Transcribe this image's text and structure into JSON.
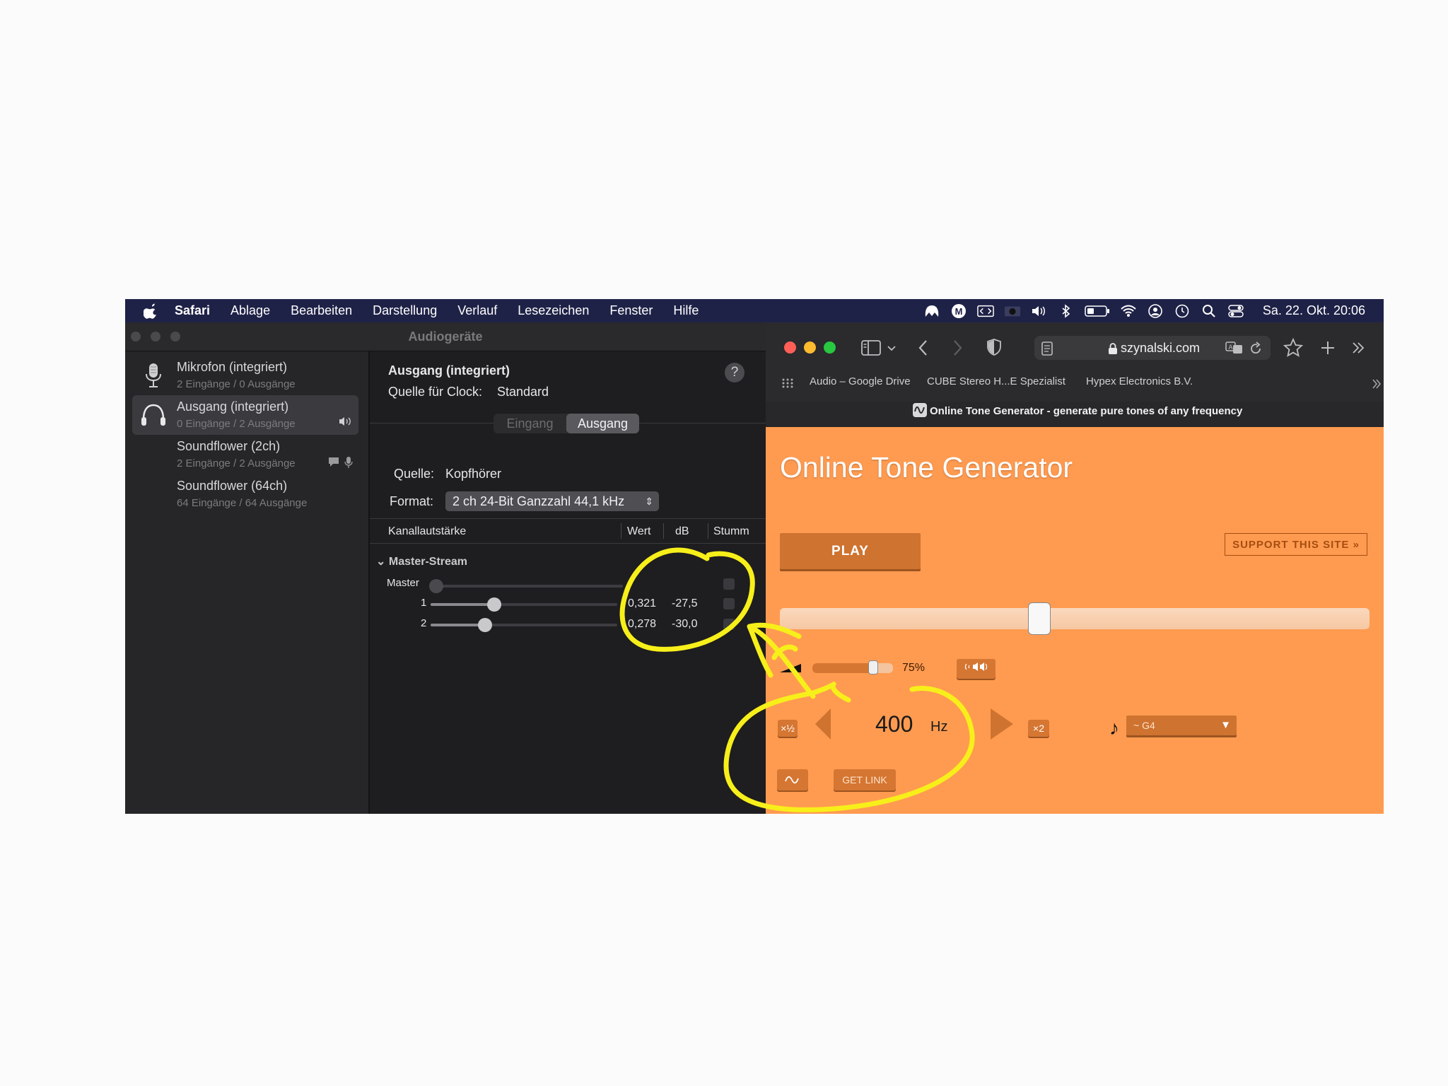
{
  "menubar": {
    "items": [
      "Safari",
      "Ablage",
      "Bearbeiten",
      "Darstellung",
      "Verlauf",
      "Lesezeichen",
      "Fenster",
      "Hilfe"
    ],
    "clock": "Sa. 22. Okt.  20:06",
    "status_icons": [
      "malwarebytes-icon",
      "m-badge-icon",
      "code-icon",
      "camera-icon",
      "volume-icon",
      "bluetooth-icon",
      "battery-icon",
      "wifi-icon",
      "user-icon",
      "time-machine-icon",
      "spotlight-icon",
      "control-center-icon"
    ]
  },
  "audio": {
    "window_title": "Audiogeräte",
    "devices": [
      {
        "name": "Mikrofon (integriert)",
        "sub": "2 Eingänge / 0 Ausgänge",
        "icon": "microphone-icon"
      },
      {
        "name": "Ausgang (integriert)",
        "sub": "0 Eingänge / 2 Ausgänge",
        "icon": "headphones-icon"
      },
      {
        "name": "Soundflower (2ch)",
        "sub": "2 Eingänge / 2 Ausgänge",
        "icon": ""
      },
      {
        "name": "Soundflower (64ch)",
        "sub": "64 Eingänge / 64 Ausgänge",
        "icon": ""
      }
    ],
    "detail_title": "Ausgang (integriert)",
    "clock_label": "Quelle für Clock:",
    "clock_value": "Standard",
    "help": "?",
    "tabs": [
      "Eingang",
      "Ausgang"
    ],
    "source_label": "Quelle:",
    "source_value": "Kopfhörer",
    "format_label": "Format:",
    "format_value": "2 ch 24-Bit Ganzzahl 44,1 kHz",
    "columns": [
      "Kanallautstärke",
      "Wert",
      "dB",
      "Stumm"
    ],
    "group": "Master-Stream",
    "channels": [
      {
        "label": "Master",
        "value": "",
        "db": "",
        "level": 0.0
      },
      {
        "label": "1",
        "value": "0,321",
        "db": "-27,5",
        "level": 0.34
      },
      {
        "label": "2",
        "value": "0,278",
        "db": "-30,0",
        "level": 0.29
      }
    ]
  },
  "safari": {
    "url": "szynalski.com",
    "bookmarks": [
      "Audio – Google Drive",
      "CUBE Stereo H...E Spezialist",
      "Hypex Electronics B.V."
    ],
    "tab_title": "Online Tone Generator - generate pure tones of any frequency",
    "page": {
      "title": "Online Tone Generator",
      "play": "PLAY",
      "support": "SUPPORT THIS SITE »",
      "frequency_slider": 0.44,
      "volume": 0.75,
      "volume_text": "75%",
      "half": "×½",
      "double": "×2",
      "freq_value": "400",
      "freq_unit": "Hz",
      "note": "~ G4",
      "get_link": "GET LINK"
    }
  },
  "colors": {
    "menubar": "#1f2247",
    "page_bg": "#ff9b50",
    "button": "#cf7330",
    "annotation": "#f7ef1a"
  }
}
